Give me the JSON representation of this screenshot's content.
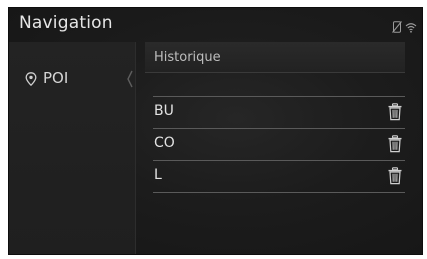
{
  "header": {
    "title": "Navigation",
    "status_icons": [
      "phone-off-icon",
      "wifi-icon"
    ]
  },
  "sidebar": {
    "items": [
      {
        "label": "POI",
        "icon": "map-pin-icon",
        "selected": true
      }
    ]
  },
  "main": {
    "section_title": "Historique",
    "history_items": [
      {
        "label": "BU",
        "action_icon": "trash-icon"
      },
      {
        "label": "CO",
        "action_icon": "trash-icon"
      },
      {
        "label": "L",
        "action_icon": "trash-icon"
      }
    ]
  },
  "colors": {
    "background": "#1c1c1c",
    "text": "#e2e2e2",
    "divider": "#5a5a5a"
  }
}
